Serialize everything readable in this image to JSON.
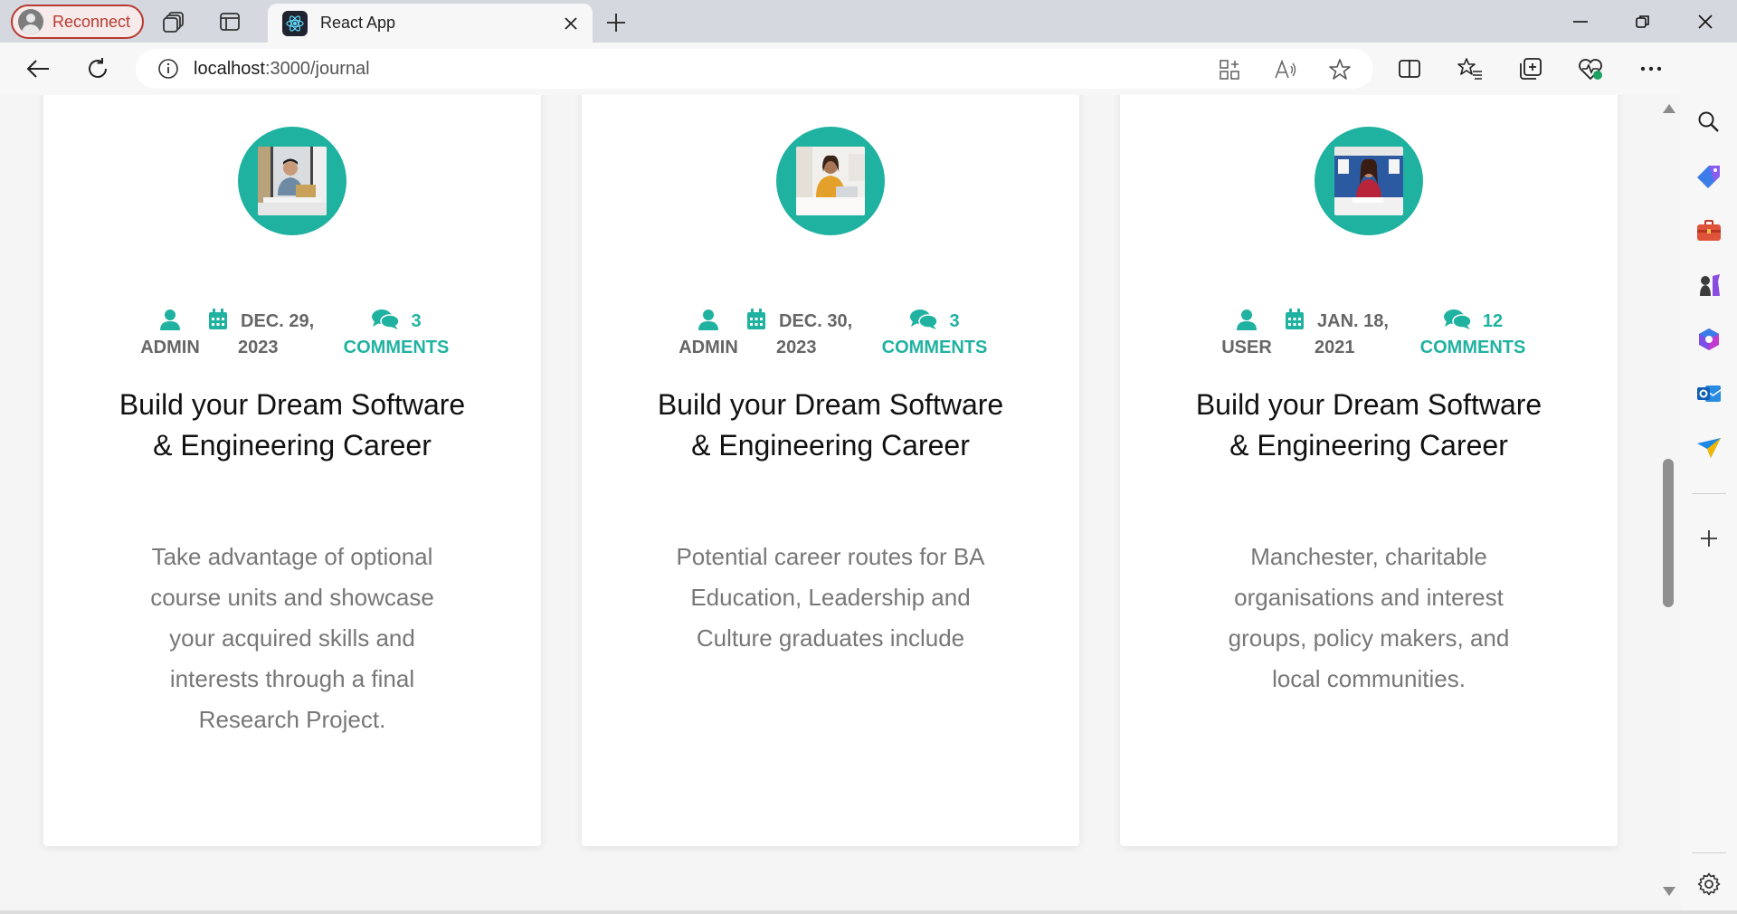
{
  "browser": {
    "reconnect_label": "Reconnect",
    "tab_title": "React App",
    "url_host": "localhost",
    "url_path": ":3000/journal"
  },
  "colors": {
    "accent": "#20b2a1",
    "reconnect": "#b83a32"
  },
  "posts": [
    {
      "author": "ADMIN",
      "date_line1": "DEC. 29,",
      "date_line2": "2023",
      "comments_count": "3",
      "comments_label": "COMMENTS",
      "title": "Build your Dream Software & Engineering Career",
      "excerpt": "Take advantage of optional course units and showcase your acquired skills and interests through a final Research Project.",
      "photo": "man-at-laptop"
    },
    {
      "author": "ADMIN",
      "date_line1": "DEC. 30,",
      "date_line2": "2023",
      "comments_count": "3",
      "comments_label": "COMMENTS",
      "title": "Build your Dream Software & Engineering Career",
      "excerpt": "Potential career routes for BA Education, Leadership and Culture graduates include",
      "photo": "woman-at-laptop"
    },
    {
      "author": "USER",
      "date_line1": "JAN. 18,",
      "date_line2": "2021",
      "comments_count": "12",
      "comments_label": "COMMENTS",
      "title": "Build your Dream Software & Engineering Career",
      "excerpt": "Manchester, charitable organisations and interest groups, policy makers, and local communities.",
      "photo": "student-writing"
    }
  ]
}
